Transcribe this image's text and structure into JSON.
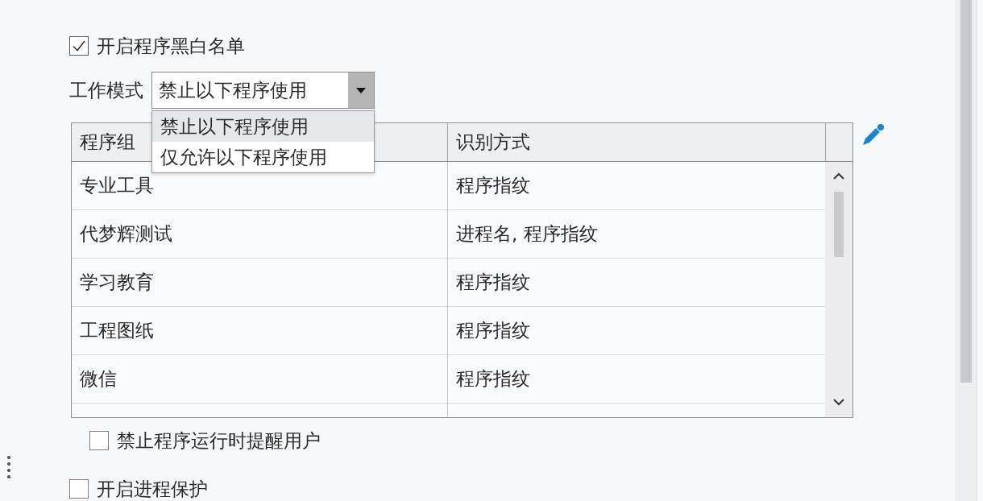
{
  "blacklist_toggle": {
    "label": "开启程序黑白名单",
    "checked": true
  },
  "work_mode": {
    "label": "工作模式",
    "value": "禁止以下程序使用",
    "expanded": true,
    "options": [
      {
        "label": "禁止以下程序使用",
        "selected": true
      },
      {
        "label": "仅允许以下程序使用",
        "selected": false
      }
    ]
  },
  "table": {
    "columns": [
      "程序组",
      "识别方式"
    ],
    "rows": [
      [
        "专业工具",
        "程序指纹"
      ],
      [
        "代梦辉测试",
        "进程名, 程序指纹"
      ],
      [
        "学习教育",
        "程序指纹"
      ],
      [
        "工程图纸",
        "程序指纹"
      ],
      [
        "微信",
        "程序指纹"
      ]
    ]
  },
  "remind_user": {
    "label": "禁止程序运行时提醒用户",
    "checked": false
  },
  "process_protection": {
    "label": "开启进程保护",
    "checked": false
  }
}
